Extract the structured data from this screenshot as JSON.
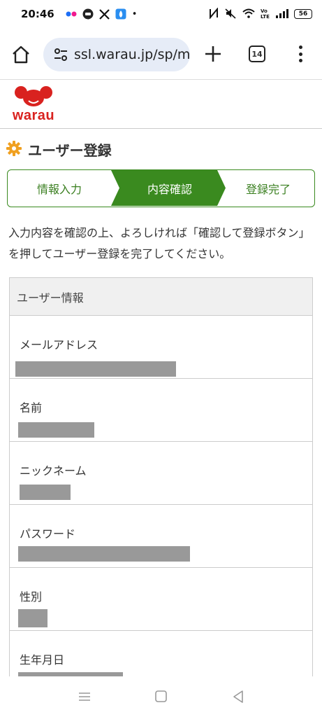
{
  "status_bar": {
    "time": "20:46",
    "apps": [
      "flickr-icon",
      "line-icon",
      "x-icon",
      "app-icon"
    ],
    "dot": "•",
    "battery": "56"
  },
  "browser": {
    "url": "ssl.warau.jp/sp/m",
    "tab_count": "14"
  },
  "site": {
    "logo_text": "warau"
  },
  "page": {
    "title": "ユーザー登録"
  },
  "steps": [
    {
      "label": "情報入力",
      "active": false
    },
    {
      "label": "内容確認",
      "active": true
    },
    {
      "label": "登録完了",
      "active": false
    }
  ],
  "intro": "入力内容を確認の上、よろしければ「確認して登録ボタン」を押してユーザー登録を完了してください。",
  "info": {
    "header": "ユーザー情報",
    "rows": [
      {
        "label": "メールアドレス"
      },
      {
        "label": "名前"
      },
      {
        "label": "ニックネーム"
      },
      {
        "label": "パスワード"
      },
      {
        "label": "性別"
      },
      {
        "label": "生年月日"
      }
    ]
  },
  "colors": {
    "accent_green": "#3a8a1f",
    "brand_red": "#d9221f",
    "redaction_gray": "#999999"
  }
}
